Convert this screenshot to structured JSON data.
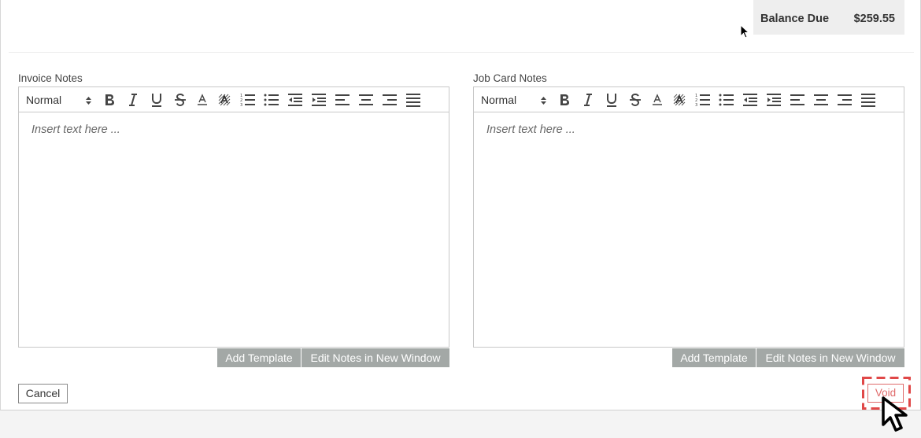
{
  "balance": {
    "label": "Balance Due",
    "value": "$259.55"
  },
  "invoice_notes": {
    "label": "Invoice Notes",
    "format_value": "Normal",
    "placeholder": "Insert text here ...",
    "add_template": "Add Template",
    "edit_window": "Edit Notes in New Window"
  },
  "job_card_notes": {
    "label": "Job Card Notes",
    "format_value": "Normal",
    "placeholder": "Insert text here ...",
    "add_template": "Add Template",
    "edit_window": "Edit Notes in New Window"
  },
  "footer": {
    "cancel": "Cancel",
    "void": "Void"
  },
  "toolbar_icons": [
    "bold-icon",
    "italic-icon",
    "underline-icon",
    "strikethrough-icon",
    "font-color-icon",
    "highlight-color-icon",
    "ordered-list-icon",
    "bullet-list-icon",
    "outdent-icon",
    "indent-icon",
    "align-left-icon",
    "align-center-icon",
    "align-right-icon",
    "align-justify-icon"
  ],
  "colors": {
    "grey_button": "#a3a8a6",
    "void_red": "#e06b6b",
    "balance_bg": "#eeeeee"
  }
}
